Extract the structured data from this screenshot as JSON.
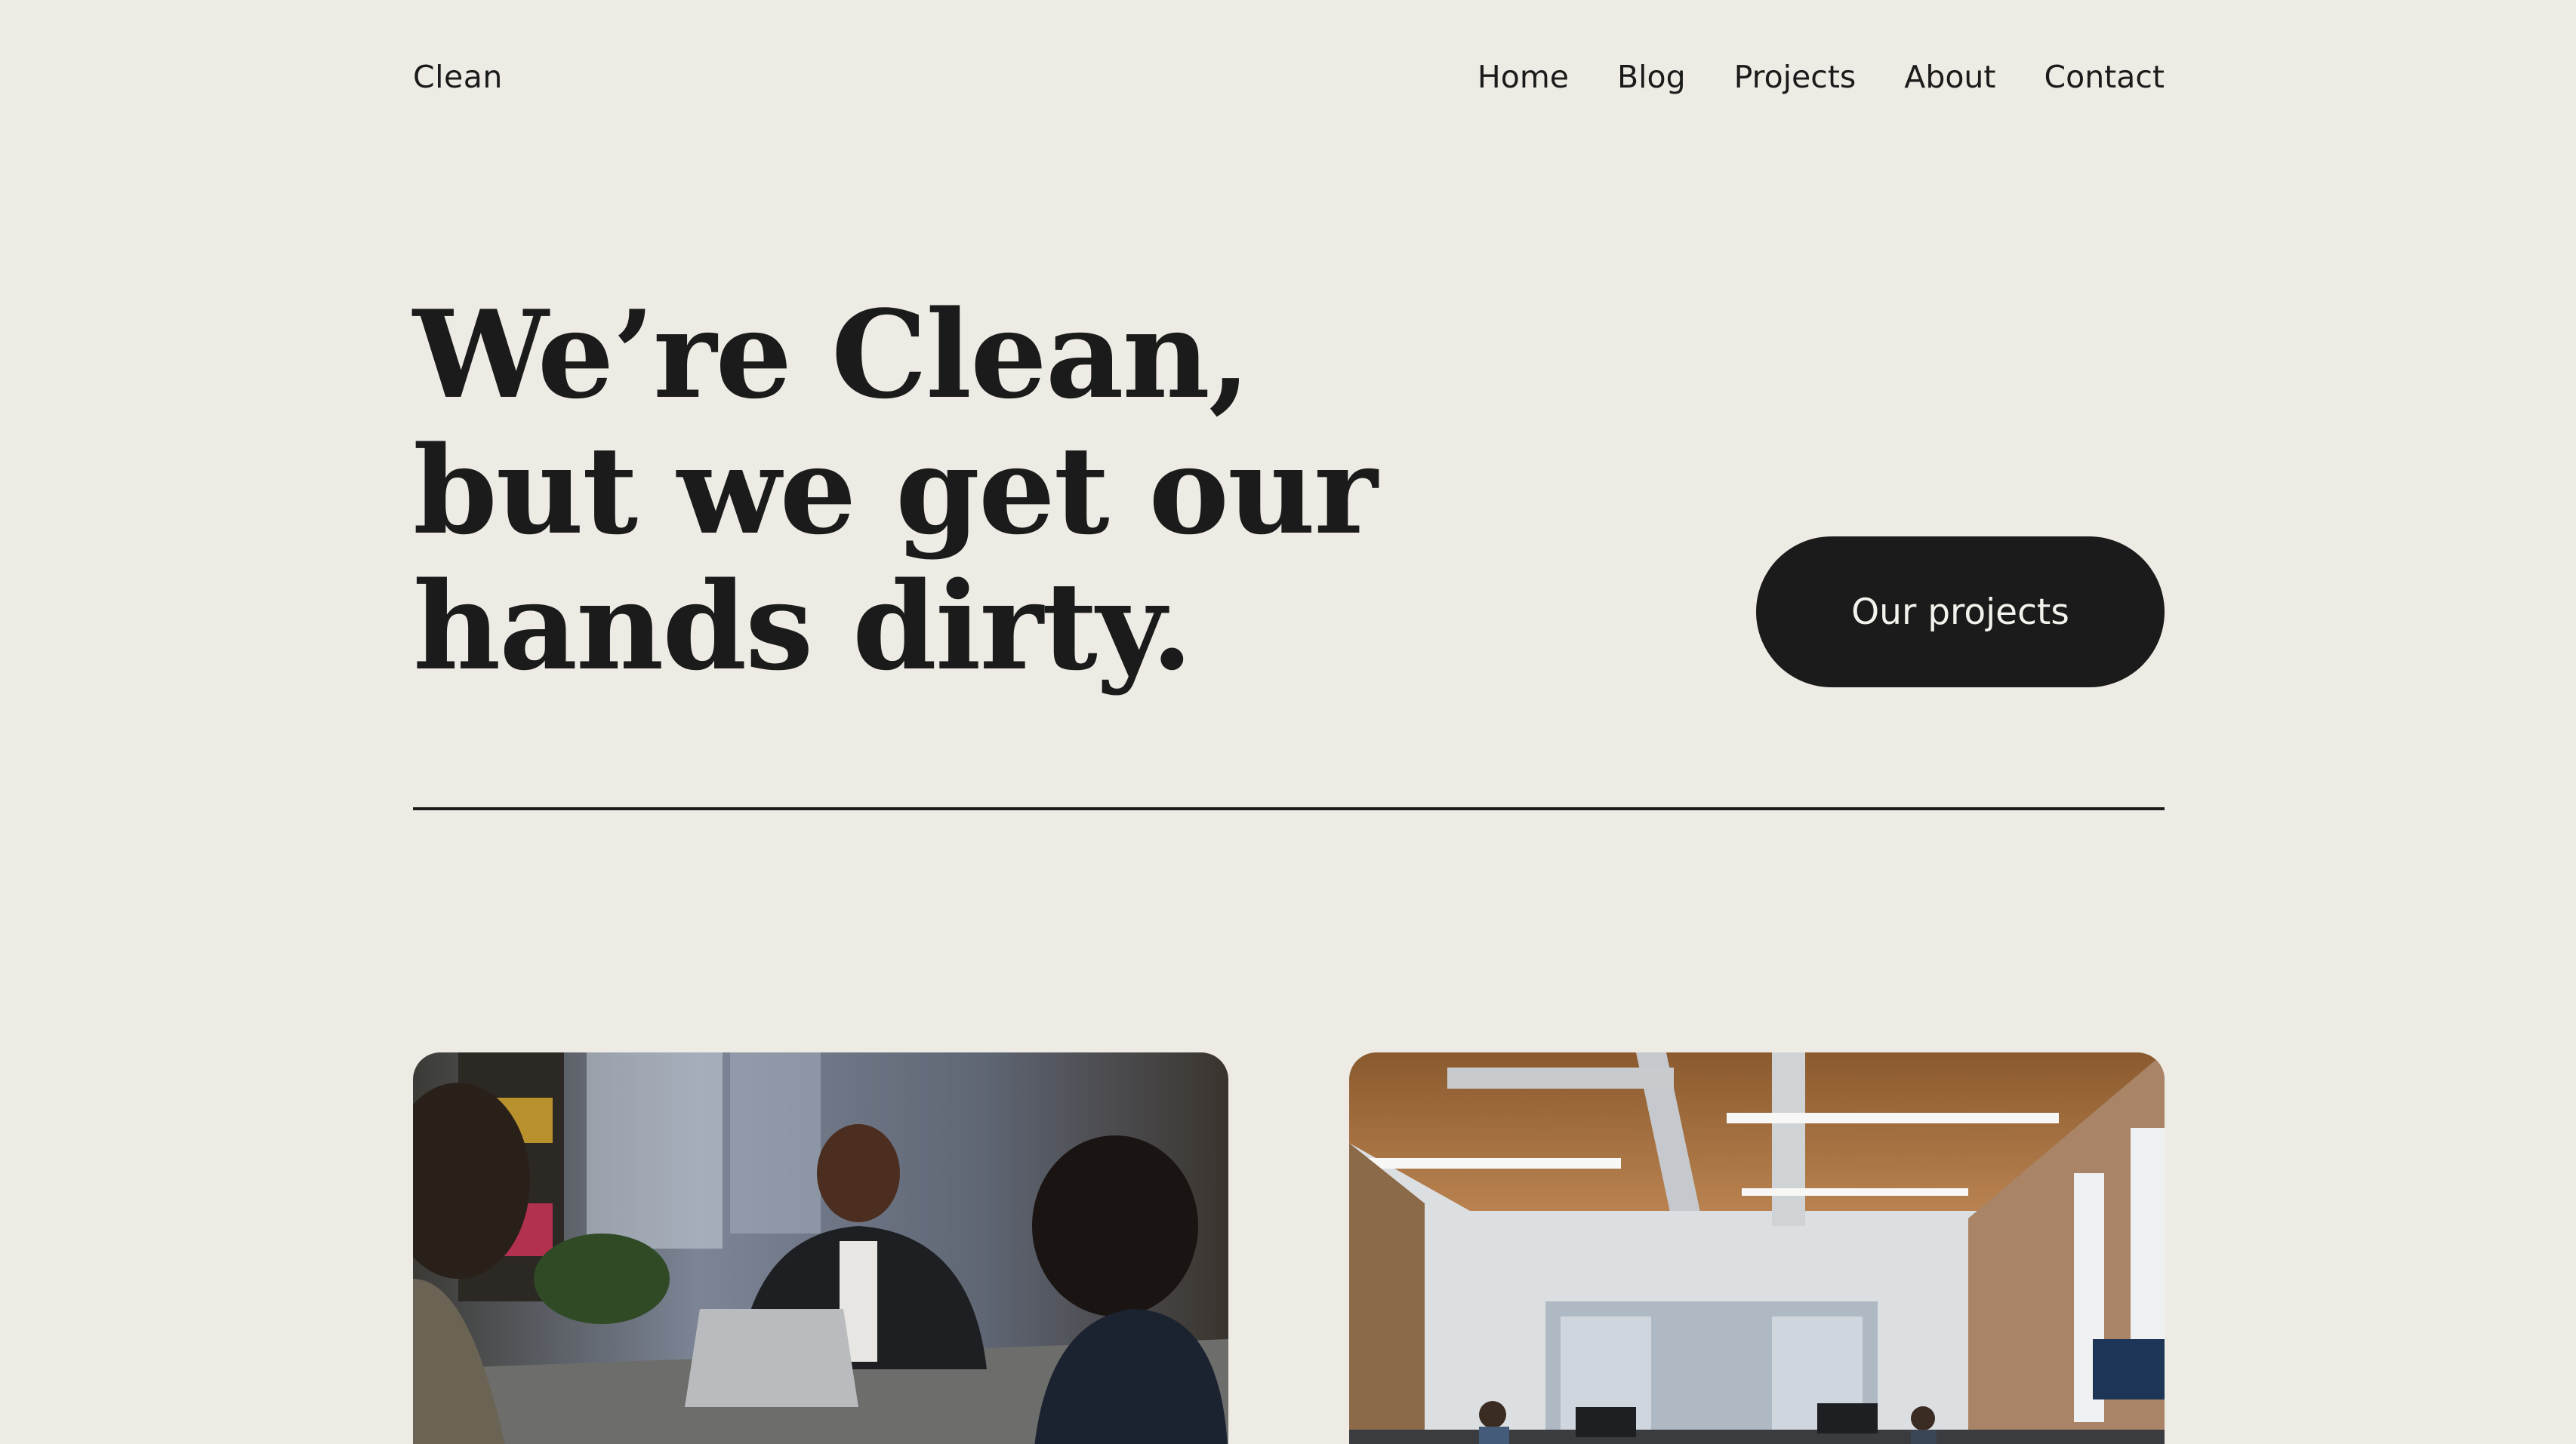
{
  "header": {
    "logo": "Clean",
    "nav": [
      {
        "label": "Home"
      },
      {
        "label": "Blog"
      },
      {
        "label": "Projects"
      },
      {
        "label": "About"
      },
      {
        "label": "Contact"
      }
    ]
  },
  "hero": {
    "title_lines": [
      "We’re Clean,",
      "but we get our",
      "hands dirty."
    ],
    "cta_label": "Our projects"
  },
  "gallery": [
    {
      "subject": "team-meeting-photo"
    },
    {
      "subject": "open-office-photo"
    }
  ],
  "colors": {
    "background": "#edebe4",
    "text": "#1b1b1b",
    "button_bg": "#1b1b1b",
    "button_text": "#f4f2ec"
  }
}
